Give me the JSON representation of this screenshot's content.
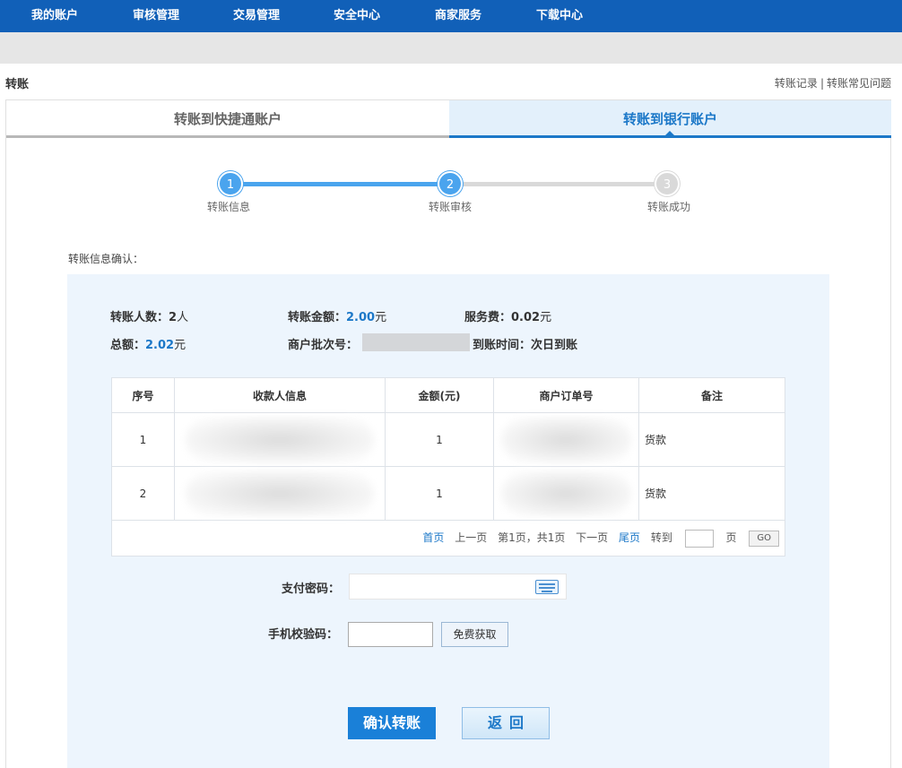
{
  "nav": {
    "items": [
      "我的账户",
      "审核管理",
      "交易管理",
      "安全中心",
      "商家服务",
      "下载中心"
    ]
  },
  "page": {
    "title": "转账",
    "links": [
      "转账记录",
      "转账常见问题"
    ],
    "separator": "|"
  },
  "tabs": [
    {
      "label": "转账到快捷通账户",
      "active": false
    },
    {
      "label": "转账到银行账户",
      "active": true
    }
  ],
  "steps": [
    {
      "num": "1",
      "label": "转账信息",
      "state": "done"
    },
    {
      "num": "2",
      "label": "转账审核",
      "state": "current"
    },
    {
      "num": "3",
      "label": "转账成功",
      "state": "pending"
    }
  ],
  "confirm": {
    "heading": "转账信息确认：",
    "people_label": "转账人数：",
    "people_value": "2",
    "people_unit": "人",
    "amount_label": "转账金额：",
    "amount_value": "2.00",
    "amount_unit": "元",
    "fee_label": "服务费：",
    "fee_value": "0.02",
    "fee_unit": "元",
    "total_label": "总额：",
    "total_value": "2.02",
    "total_unit": "元",
    "batch_label": "商户批次号：",
    "arrival_label": "到账时间：",
    "arrival_value": "次日到账"
  },
  "table": {
    "headers": [
      "序号",
      "收款人信息",
      "金额(元)",
      "商户订单号",
      "备注"
    ],
    "rows": [
      {
        "no": "1",
        "amount": "1",
        "memo": "货款"
      },
      {
        "no": "2",
        "amount": "1",
        "memo": "货款"
      }
    ]
  },
  "pager": {
    "first": "首页",
    "prev": "上一页",
    "info": "第1页，共1页",
    "next": "下一页",
    "last": "尾页",
    "goto": "转到",
    "page_unit": "页",
    "go": "GO"
  },
  "form": {
    "password_label": "支付密码：",
    "sms_label": "手机校验码：",
    "sms_button": "免费获取"
  },
  "actions": {
    "confirm": "确认转账",
    "back": "返回"
  },
  "colors": {
    "nav": "#1160b8",
    "accent": "#1c78c8",
    "panel": "#edf5fd",
    "step_active": "#4aa4ee"
  }
}
